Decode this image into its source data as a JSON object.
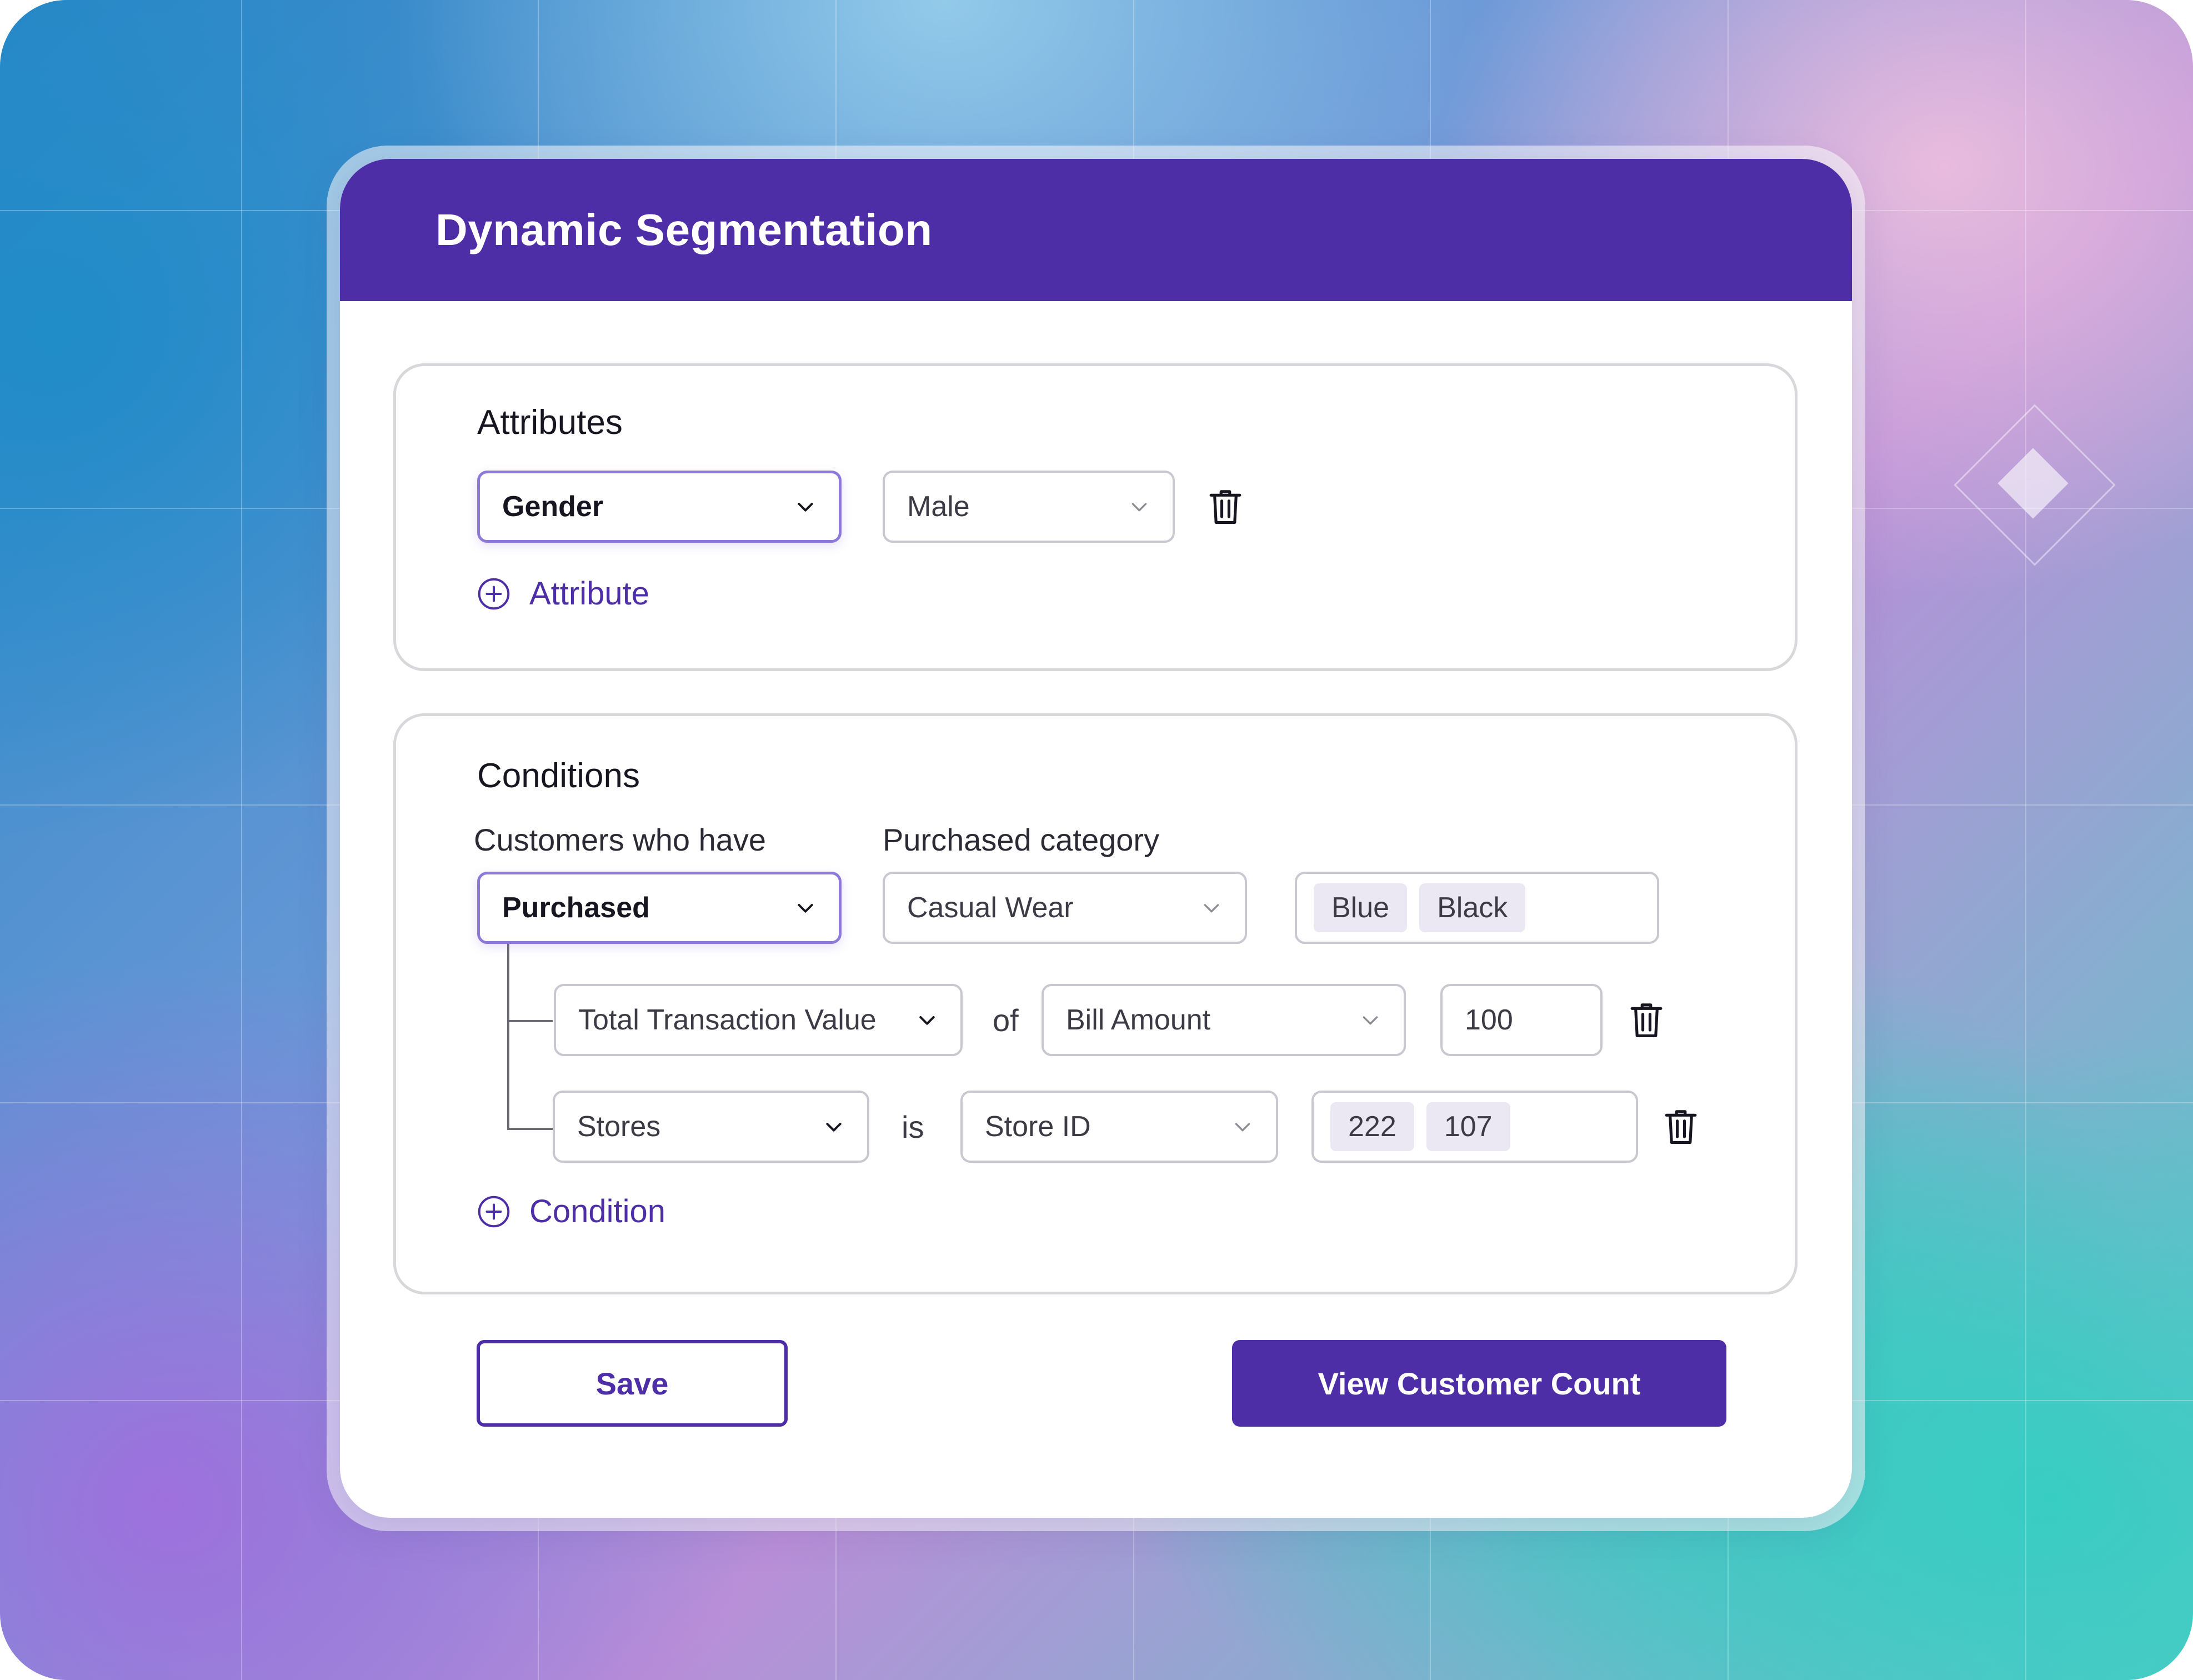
{
  "header": {
    "title": "Dynamic Segmentation"
  },
  "attributes": {
    "title": "Attributes",
    "rows": [
      {
        "attribute": "Gender",
        "value": "Male"
      }
    ],
    "add_label": "Attribute"
  },
  "conditions": {
    "title": "Conditions",
    "customers_label": "Customers who have",
    "category_label": "Purchased category",
    "action": "Purchased",
    "category": "Casual Wear",
    "category_tags": [
      "Blue",
      "Black"
    ],
    "sub_rows": [
      {
        "metric": "Total Transaction Value",
        "connector": "of",
        "field": "Bill Amount",
        "value": "100"
      },
      {
        "metric": "Stores",
        "connector": "is",
        "field": "Store ID",
        "tags": [
          "222",
          "107"
        ]
      }
    ],
    "add_label": "Condition"
  },
  "actions": {
    "save_label": "Save",
    "count_label": "View Customer Count"
  },
  "colors": {
    "brand": "#4e2ea7",
    "accent_border": "#8f79d8",
    "tag_bg": "#ebe8f4"
  },
  "icons": {
    "dropdown": "chevron-down-icon",
    "delete": "trash-icon",
    "add": "plus-circle-icon"
  }
}
